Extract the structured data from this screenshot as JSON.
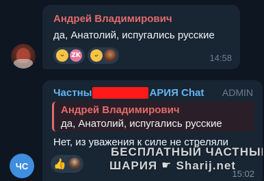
{
  "message1": {
    "sender": "Андрей Владимирович",
    "text": "да, Анатолий, испугались русские",
    "reactions": [
      {
        "icon": "grinning-face-icon"
      },
      {
        "icon": "zk-sticker-icon",
        "label": "ZK"
      },
      {
        "icon": "rolling-laughing-face-icon"
      },
      {
        "icon": "user-avatar-icon"
      }
    ],
    "time": "14:58"
  },
  "message2": {
    "avatar_initials": "ЧС",
    "channel_prefix": "Частны",
    "channel_suffix": "АРИЯ Chat",
    "admin_tag": "ADMIN",
    "reply": {
      "sender": "Андрей Владимирович",
      "text": "да, Анатолий, испугались русские"
    },
    "text": "Нет, из уважения к силе не стреляли",
    "reactions": [
      {
        "icon": "thumbs-up-icon"
      },
      {
        "icon": "user-avatar-icon"
      }
    ],
    "time": "15:02",
    "watermark_line1": "БЕСПЛАТНЫЙ ЧАСТНЫЙ",
    "watermark_line2": "ШАРИЯ",
    "watermark_site": "Sharij.net"
  },
  "colors": {
    "background": "#0e1621",
    "bubble": "#182533",
    "sender_name": "#e26b6b",
    "channel_name": "#64b5ef",
    "redaction": "#ff1a1a"
  }
}
